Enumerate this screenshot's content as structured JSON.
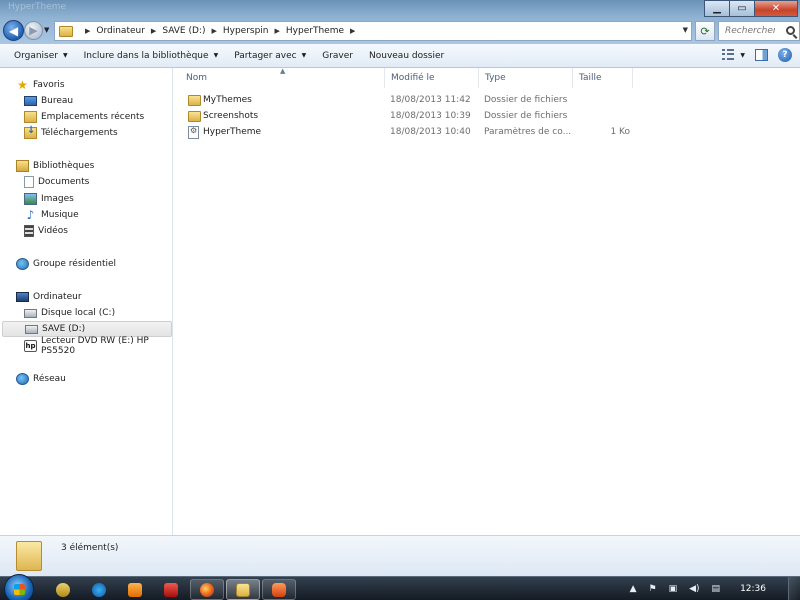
{
  "window": {
    "title": "HyperTheme"
  },
  "address_bar": {
    "crumbs": [
      "Ordinateur",
      "SAVE (D:)",
      "Hyperspin",
      "HyperTheme"
    ]
  },
  "search": {
    "placeholder": "Rechercher..."
  },
  "toolbar": {
    "organize": "Organiser",
    "include_library": "Inclure dans la bibliothèque",
    "share_with": "Partager avec",
    "burn": "Graver",
    "new_folder": "Nouveau dossier"
  },
  "sidebar": {
    "favorites": {
      "label": "Favoris",
      "items": [
        "Bureau",
        "Emplacements récents",
        "Téléchargements"
      ]
    },
    "libraries": {
      "label": "Bibliothèques",
      "items": [
        "Documents",
        "Images",
        "Musique",
        "Vidéos"
      ]
    },
    "homegroup": {
      "label": "Groupe résidentiel"
    },
    "computer": {
      "label": "Ordinateur",
      "items": [
        "Disque local (C:)",
        "SAVE (D:)",
        "Lecteur DVD RW (E:) HP PS5520"
      ]
    },
    "network": {
      "label": "Réseau"
    },
    "selected": "SAVE (D:)"
  },
  "columns": {
    "name": "Nom",
    "modified": "Modifié le",
    "type": "Type",
    "size": "Taille"
  },
  "files": [
    {
      "name": "MyThemes",
      "modified": "18/08/2013 11:42",
      "type": "Dossier de fichiers",
      "size": "",
      "icon": "folder-icon"
    },
    {
      "name": "Screenshots",
      "modified": "18/08/2013 10:39",
      "type": "Dossier de fichiers",
      "size": "",
      "icon": "folder-icon"
    },
    {
      "name": "HyperTheme",
      "modified": "18/08/2013 10:40",
      "type": "Paramètres de co...",
      "size": "1 Ko",
      "icon": "settings-file-icon"
    }
  ],
  "details": {
    "count": "3 élément(s)"
  },
  "taskbar": {
    "clock": "12:36"
  }
}
